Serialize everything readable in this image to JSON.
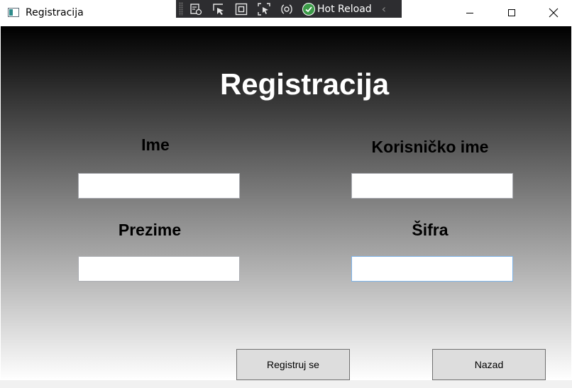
{
  "window": {
    "title": "Registracija",
    "controls": [
      "minimize-icon",
      "maximize-icon",
      "close-icon"
    ]
  },
  "debug_toolbar": {
    "icons": [
      "select-element-icon",
      "select-cursor-icon",
      "display-layout-icon",
      "track-focus-icon",
      "binding-icon"
    ],
    "hot_reload_label": "Hot Reload",
    "collapse_icon": "chevron-left-icon"
  },
  "form": {
    "heading": "Registracija",
    "first_name_label": "Ime",
    "last_name_label": "Prezime",
    "username_label": "Korisničko ime",
    "password_label": "Šifra",
    "first_name_value": "",
    "last_name_value": "",
    "username_value": "",
    "password_value": ""
  },
  "buttons": {
    "register_label": "Registruj se",
    "back_label": "Nazad"
  },
  "colors": {
    "gradient_top": "#000000",
    "gradient_bottom": "#ffffff",
    "heading_text": "#ffffff",
    "button_bg": "#dddddd",
    "hot_reload_check": "#3c9b48",
    "focused_input_border": "#7eb4ea"
  }
}
